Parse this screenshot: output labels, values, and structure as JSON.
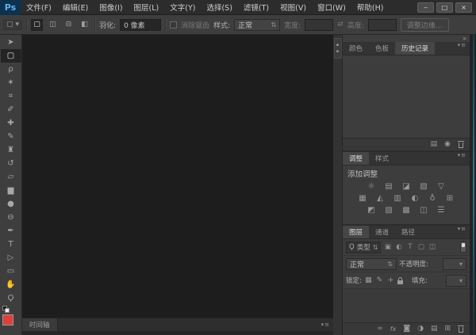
{
  "app": {
    "logo_text": "Ps",
    "window_controls": {
      "minimize": "‒",
      "maximize": "□",
      "close": "×"
    }
  },
  "menu": {
    "items": [
      "文件(F)",
      "编辑(E)",
      "图像(I)",
      "图层(L)",
      "文字(Y)",
      "选择(S)",
      "滤镜(T)",
      "视图(V)",
      "窗口(W)",
      "帮助(H)"
    ]
  },
  "options": {
    "preset_glyph": "▢",
    "preset_arrow": "▾",
    "mode_buttons": [
      "▢",
      "◫",
      "⊟",
      "◧"
    ],
    "feather_label": "羽化:",
    "feather_value": "0 像素",
    "antialias_label": "消除锯齿",
    "style_label": "样式:",
    "style_value": "正常",
    "style_stepper": "⇅",
    "width_label": "宽度:",
    "swap_glyph": "⇄",
    "height_label": "高度:",
    "refine_edge_label": "调整边缘…"
  },
  "tools": [
    {
      "glyph": "➤"
    },
    {
      "glyph": "▢"
    },
    {
      "glyph": "ρ"
    },
    {
      "glyph": "✶"
    },
    {
      "glyph": "⌗"
    },
    {
      "glyph": "✐"
    },
    {
      "glyph": "✚"
    },
    {
      "glyph": "✎"
    },
    {
      "glyph": "♜"
    },
    {
      "glyph": "↺"
    },
    {
      "glyph": "▱"
    },
    {
      "glyph": "▆"
    },
    {
      "glyph": "●"
    },
    {
      "glyph": "⊖"
    },
    {
      "glyph": "✒"
    },
    {
      "glyph": "T"
    },
    {
      "glyph": "▷"
    },
    {
      "glyph": "▭"
    },
    {
      "glyph": "✋"
    },
    {
      "glyph": "Ϙ"
    }
  ],
  "colors": {
    "foreground": "#e13d3d",
    "accent_blue": "#61b3e8"
  },
  "dock": {
    "collapse_glyph": "»",
    "panel_menu_glyph": "▾≡"
  },
  "history_panel": {
    "tabs": [
      "颜色",
      "色板",
      "历史记录"
    ],
    "active_tab": "历史记录",
    "new_doc_glyph": "▤",
    "snapshot_glyph": "◉"
  },
  "adjustments_panel": {
    "tabs": [
      "调整",
      "样式"
    ],
    "active_tab": "调整",
    "header": "添加调整",
    "icon_rows": [
      [
        "☼",
        "▤",
        "◪",
        "▨",
        "▽"
      ],
      [
        "▦",
        "◭",
        "▥",
        "◐",
        "♁",
        "⊞"
      ],
      [
        "◩",
        "▧",
        "▩",
        "◫",
        "☰"
      ]
    ]
  },
  "layers_panel": {
    "tabs": [
      "图层",
      "通道",
      "路径"
    ],
    "active_tab": "图层",
    "filter": {
      "search_glyph": "Ϙ",
      "label": "类型",
      "stepper": "⇅",
      "icons": [
        "▣",
        "◐",
        "T",
        "▢",
        "◫"
      ]
    },
    "blend": {
      "value": "正常",
      "stepper": "⇅",
      "opacity_label": "不透明度:",
      "opacity_arrow": "▾"
    },
    "lock": {
      "label": "锁定:",
      "icons": [
        "▦",
        "✎",
        "+"
      ],
      "fill_label": "填充:",
      "fill_arrow": "▾"
    },
    "buttons": {
      "link": "∞",
      "fx": "fx",
      "mask": "◙",
      "adjustment": "◑",
      "group": "▤",
      "new_layer": "⊞"
    }
  },
  "timeline": {
    "tab_label": "时间轴",
    "menu_glyph": "▾≡"
  }
}
